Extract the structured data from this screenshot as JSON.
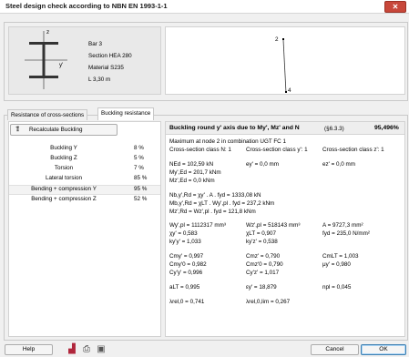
{
  "window": {
    "title": "Steel design check according to NBN EN 1993-1-1",
    "close_icon": "close-icon"
  },
  "member": {
    "name": "Bar 3",
    "section": "Section HEA 280",
    "material": "Material S235",
    "length": "L 3,30 m",
    "axis_z": "z",
    "axis_y": "y'",
    "node_start": "2",
    "node_end": "4"
  },
  "tabs": [
    {
      "label": "Resistance of cross-sections",
      "active": false
    },
    {
      "label": "Buckling resistance",
      "active": true
    }
  ],
  "recalc_button": {
    "label": "Recalculate Buckling",
    "icon": "buckling-calc-icon"
  },
  "checks": [
    {
      "name": "Buckling Y",
      "pct": "8 %"
    },
    {
      "name": "Buckling Z",
      "pct": "5 %"
    },
    {
      "name": "Torsion",
      "pct": "7 %"
    },
    {
      "name": "Lateral torsion",
      "pct": "85 %"
    },
    {
      "name": "Bending + compression Y",
      "pct": "95 %",
      "selected": true
    },
    {
      "name": "Bending + compression Z",
      "pct": "52 %"
    }
  ],
  "result": {
    "header": "Buckling round y' axis due to My', Mz' and N",
    "clause": "(§6.3.3)",
    "ratio": "95,496%",
    "max_line": "Maximum at node 2 in combination UGT FC 1",
    "class": [
      "Cross-section class N: 1",
      "Cross-section class y': 1",
      "Cross-section class z': 1"
    ],
    "forces": [
      "NEd = 102,59 kN",
      "My',Ed = 201,7 kNm",
      "Mz',Ed = 0,0 kNm"
    ],
    "ecc": [
      "ey' = 0,0 mm",
      "ez' = 0,0 mm"
    ],
    "resistances": [
      "Nb,y',Rd = χy' . A . fyd = 1333,08 kN",
      "Mb,y',Rd = χLT . Wy',pl . fyd = 237,2 kNm",
      "Mz',Rd = Wz',pl . fyd = 121,8 kNm"
    ],
    "props_col1": [
      "Wy',pl = 1112317 mm³",
      "χy' = 0,583",
      "ky'y' = 1,033"
    ],
    "props_col2": [
      "Wz',pl = 518143 mm³",
      "χLT = 0,907",
      "ky'z' = 0,538"
    ],
    "props_col3": [
      "A = 9727,3 mm²",
      "fyd = 235,0 N/mm²"
    ],
    "coef_col1": [
      "Cmy' = 0,997",
      "Cmy'0 = 0,982",
      "Cy'y' = 0,996"
    ],
    "coef_col2": [
      "Cmz' = 0,790",
      "Cmz'0 = 0,790",
      "Cy'z' = 1,017"
    ],
    "coef_col3": [
      "CmLT = 1,003",
      "μy' = 0,980"
    ],
    "alpha": [
      "aLT = 0,995",
      "εy' = 18,879",
      "npl = 0,045"
    ],
    "lambda": [
      "λrel,0 = 0,741",
      "λrel,0,lim = 0,267"
    ]
  },
  "footer": {
    "help": "Help",
    "cancel": "Cancel",
    "ok": "OK",
    "icons": [
      "chart-icon",
      "print-icon",
      "preview-icon"
    ]
  }
}
